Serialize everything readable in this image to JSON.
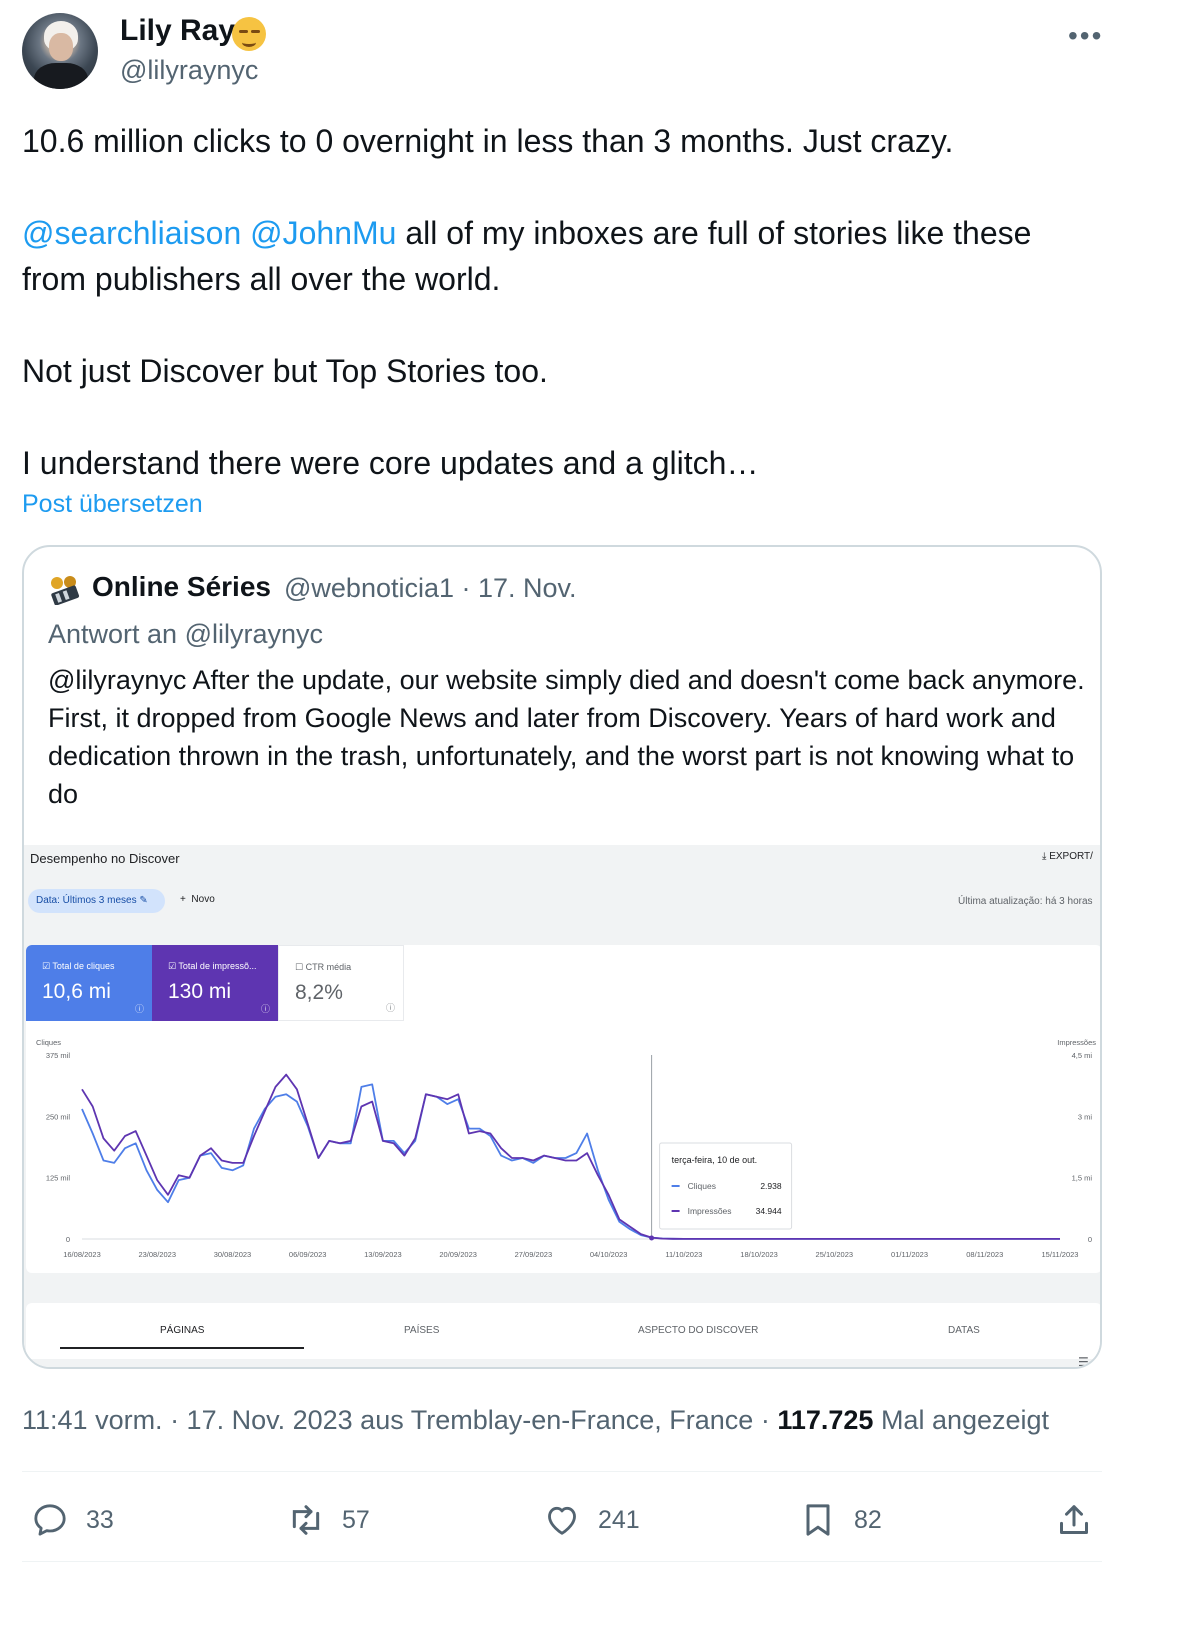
{
  "author": {
    "name": "Lily Ray",
    "handle": "@lilyraynyc",
    "emoji": "relieved-face"
  },
  "more_label": "•••",
  "tweet": {
    "line1": "10.6 million clicks to 0 overnight in less than 3 months. Just crazy.",
    "mention1": "@searchliaison",
    "mention2": "@JohnMu",
    "line2a": " all of my inboxes are full of stories like these",
    "line2b": "from publishers all over the world.",
    "line3": "Not just Discover but Top Stories too.",
    "line4": "I understand there were core updates and a glitch…"
  },
  "translate_label": "Post übersetzen",
  "quote": {
    "name": "Online Séries",
    "handle_date": "@webnoticia1 · 17. Nov.",
    "reply_to": "Antwort an @lilyraynyc",
    "text": "@lilyraynyc After the update, our website simply died and doesn't come back anymore. First, it dropped from Google News and later from Discovery. Years of hard work and dedication thrown in the trash, unfortunately, and the worst part is not knowing what to do",
    "screenshot": {
      "title": "Desempenho no Discover",
      "export": "EXPORT/",
      "date_chip": "Data: Últimos 3 meses",
      "novo": "Novo",
      "last_update": "Última atualização: há 3 horas",
      "metrics": [
        {
          "label": "Total de cliques",
          "value": "10,6 mi",
          "checked": true
        },
        {
          "label": "Total de impressõ...",
          "value": "130 mi",
          "checked": true
        },
        {
          "label": "CTR média",
          "value": "8,2%",
          "checked": false
        }
      ],
      "tabs": [
        "PÁGINAS",
        "PAÍSES",
        "ASPECTO DO DISCOVER",
        "DATAS"
      ],
      "tooltip": {
        "date": "terça-feira, 10 de out.",
        "rows": [
          {
            "label": "Cliques",
            "value": "2.938"
          },
          {
            "label": "Impressões",
            "value": "34.944"
          }
        ]
      },
      "colors": {
        "clicks": "#4e7ee8",
        "impressions": "#5e35b1"
      }
    }
  },
  "chart_data": {
    "type": "line",
    "ylabel": "Cliques",
    "y2label": "Impressões",
    "y_ticks": [
      "375 mil",
      "250 mil",
      "125 mil",
      "0"
    ],
    "y2_ticks": [
      "4,5 mi",
      "3 mi",
      "1,5 mi",
      "0"
    ],
    "ylim": [
      0,
      375000
    ],
    "y2lim": [
      0,
      4500000
    ],
    "x_tick_labels": [
      "16/08/2023",
      "23/08/2023",
      "30/08/2023",
      "06/09/2023",
      "13/09/2023",
      "20/09/2023",
      "27/09/2023",
      "04/10/2023",
      "11/10/2023",
      "18/10/2023",
      "25/10/2023",
      "01/11/2023",
      "08/11/2023",
      "15/11/2023"
    ],
    "x_start": "16/08/2023",
    "x_end": "15/11/2023",
    "series": [
      {
        "name": "Cliques",
        "axis": "left",
        "values": [
          265000,
          215000,
          160000,
          155000,
          185000,
          195000,
          140000,
          100000,
          75000,
          120000,
          125000,
          170000,
          175000,
          145000,
          140000,
          150000,
          225000,
          265000,
          290000,
          295000,
          280000,
          230000,
          165000,
          200000,
          195000,
          195000,
          310000,
          315000,
          200000,
          200000,
          175000,
          200000,
          295000,
          290000,
          275000,
          285000,
          225000,
          225000,
          210000,
          170000,
          160000,
          165000,
          155000,
          170000,
          165000,
          165000,
          175000,
          215000,
          140000,
          80000,
          35000,
          20000,
          8000,
          2938,
          1000,
          500,
          300,
          200,
          200,
          200,
          200,
          200,
          200,
          200,
          200,
          200,
          200,
          200,
          200,
          200,
          200,
          200,
          200,
          200,
          200,
          200,
          200,
          200,
          200,
          200,
          200,
          200,
          200,
          200,
          200,
          200,
          200,
          200,
          200,
          200,
          200,
          200
        ]
      },
      {
        "name": "Impressões",
        "axis": "right",
        "values": [
          3660000,
          3240000,
          2460000,
          2160000,
          2520000,
          2640000,
          2040000,
          1440000,
          1080000,
          1560000,
          1500000,
          2040000,
          2220000,
          1920000,
          1860000,
          1860000,
          2520000,
          3120000,
          3720000,
          4020000,
          3660000,
          2820000,
          1980000,
          2400000,
          2340000,
          2400000,
          3240000,
          3360000,
          2400000,
          2340000,
          2040000,
          2460000,
          3540000,
          3480000,
          3420000,
          3540000,
          2580000,
          2640000,
          2580000,
          2220000,
          1980000,
          1980000,
          1920000,
          2040000,
          1980000,
          1920000,
          1920000,
          2100000,
          1560000,
          1080000,
          480000,
          300000,
          120000,
          34944,
          10000,
          5000,
          3000,
          2000,
          2000,
          2000,
          2000,
          2000,
          2000,
          2000,
          2000,
          2000,
          2000,
          2000,
          2000,
          2000,
          2000,
          2000,
          2000,
          2000,
          2000,
          2000,
          2000,
          2000,
          2000,
          2000,
          2000,
          2000,
          2000,
          2000,
          2000,
          2000,
          2000,
          2000,
          2000,
          2000,
          2000,
          2000
        ]
      }
    ],
    "highlight": {
      "date": "10/10/2023",
      "index": 53
    },
    "grid": false,
    "legend": "none"
  },
  "footer": {
    "time_place": "11:41 vorm. · 17. Nov. 2023 aus Tremblay-en-France, France · ",
    "views": "117.725",
    "views_suffix": " Mal angezeigt"
  },
  "actions": {
    "replies": "33",
    "reposts": "57",
    "likes": "241",
    "bookmarks": "82"
  }
}
